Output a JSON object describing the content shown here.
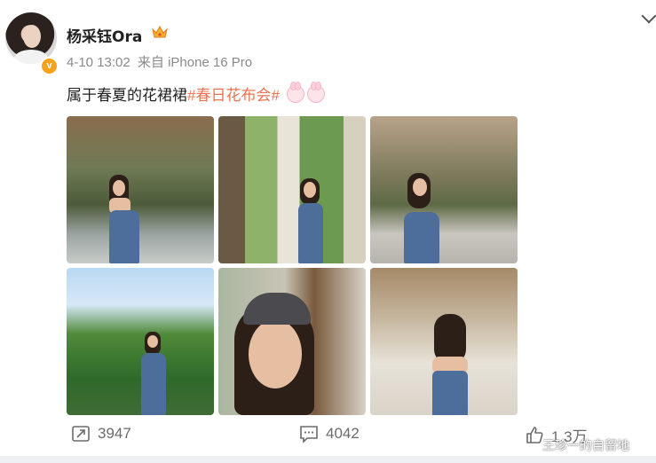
{
  "header": {
    "username": "杨采钰Ora",
    "timestamp": "4-10 13:02",
    "source": "来自 iPhone 16 Pro",
    "verified_mark": "v"
  },
  "post": {
    "text": "属于春夏的花裙裙",
    "hashtag": "#春日花布会#",
    "emoji_icon": "bunny-emoji-icon"
  },
  "photos": [
    {
      "name": "photo-1"
    },
    {
      "name": "photo-2"
    },
    {
      "name": "photo-3"
    },
    {
      "name": "photo-4"
    },
    {
      "name": "photo-5"
    },
    {
      "name": "photo-6"
    }
  ],
  "actions": {
    "repost_count": "3947",
    "comment_count": "4042",
    "like_count": "1.3万"
  },
  "watermark": "王珍一的自留地",
  "colors": {
    "hashtag": "#eb7350",
    "verified": "#f7a21b",
    "meta_text": "#8a8a8a"
  }
}
